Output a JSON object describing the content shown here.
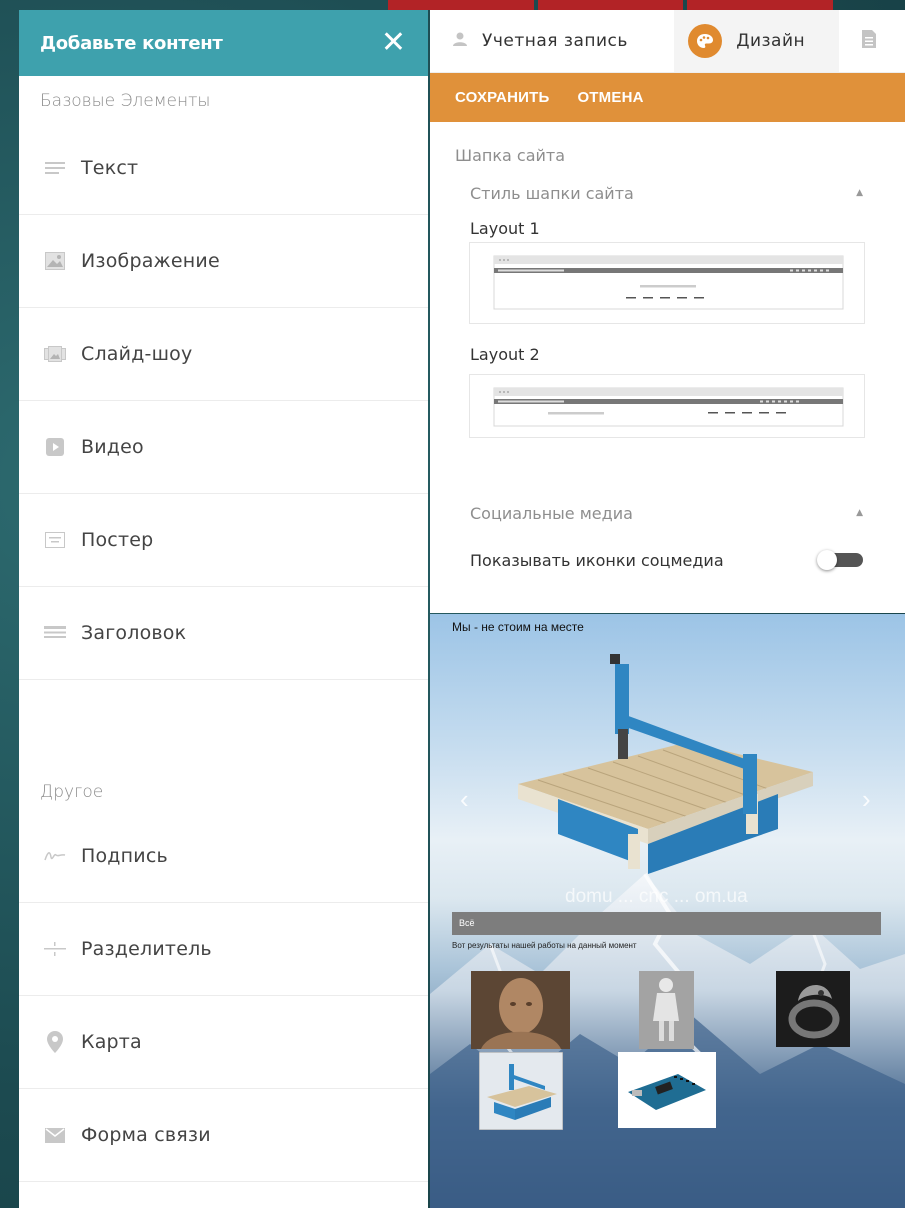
{
  "left_panel": {
    "title": "Добавьте контент",
    "basic_section": "Базовые Элементы",
    "basic_items": [
      {
        "label": "Текст",
        "icon": "text-lines-icon"
      },
      {
        "label": "Изображение",
        "icon": "image-icon"
      },
      {
        "label": "Слайд-шоу",
        "icon": "slideshow-icon"
      },
      {
        "label": "Видео",
        "icon": "video-icon"
      },
      {
        "label": "Постер",
        "icon": "poster-icon"
      },
      {
        "label": "Заголовок",
        "icon": "heading-icon"
      }
    ],
    "other_section": "Другое",
    "other_items": [
      {
        "label": "Подпись",
        "icon": "signature-icon"
      },
      {
        "label": "Разделитель",
        "icon": "divider-icon"
      },
      {
        "label": "Карта",
        "icon": "map-pin-icon"
      },
      {
        "label": "Форма связи",
        "icon": "mail-icon"
      }
    ]
  },
  "right_panel": {
    "tabs": [
      {
        "label": "Учетная запись",
        "icon": "user-icon"
      },
      {
        "label": "Дизайн",
        "icon": "palette-icon"
      },
      {
        "label": "",
        "icon": "document-icon"
      }
    ],
    "save_label": "СОХРАНИТЬ",
    "cancel_label": "ОТМЕНА",
    "section_header": "Шапка сайта",
    "header_style_title": "Стиль шапки сайта",
    "layout1_label": "Layout 1",
    "layout2_label": "Layout 2",
    "social_title": "Социальные медиа",
    "social_toggle_label": "Показывать иконки соцмедиа",
    "social_toggle_on": false
  },
  "preview": {
    "title": "Мы - не стоим на месте",
    "watermark": "domu ... cnc ... om.ua",
    "filter_label": "Всё",
    "subtitle": "Вот результаты нашей работы на данный момент"
  },
  "colors": {
    "left_header": "#3ea1ad",
    "action_bar": "#e0913a",
    "palette_accent": "#e08a2f",
    "top_strip": "#b22326"
  }
}
